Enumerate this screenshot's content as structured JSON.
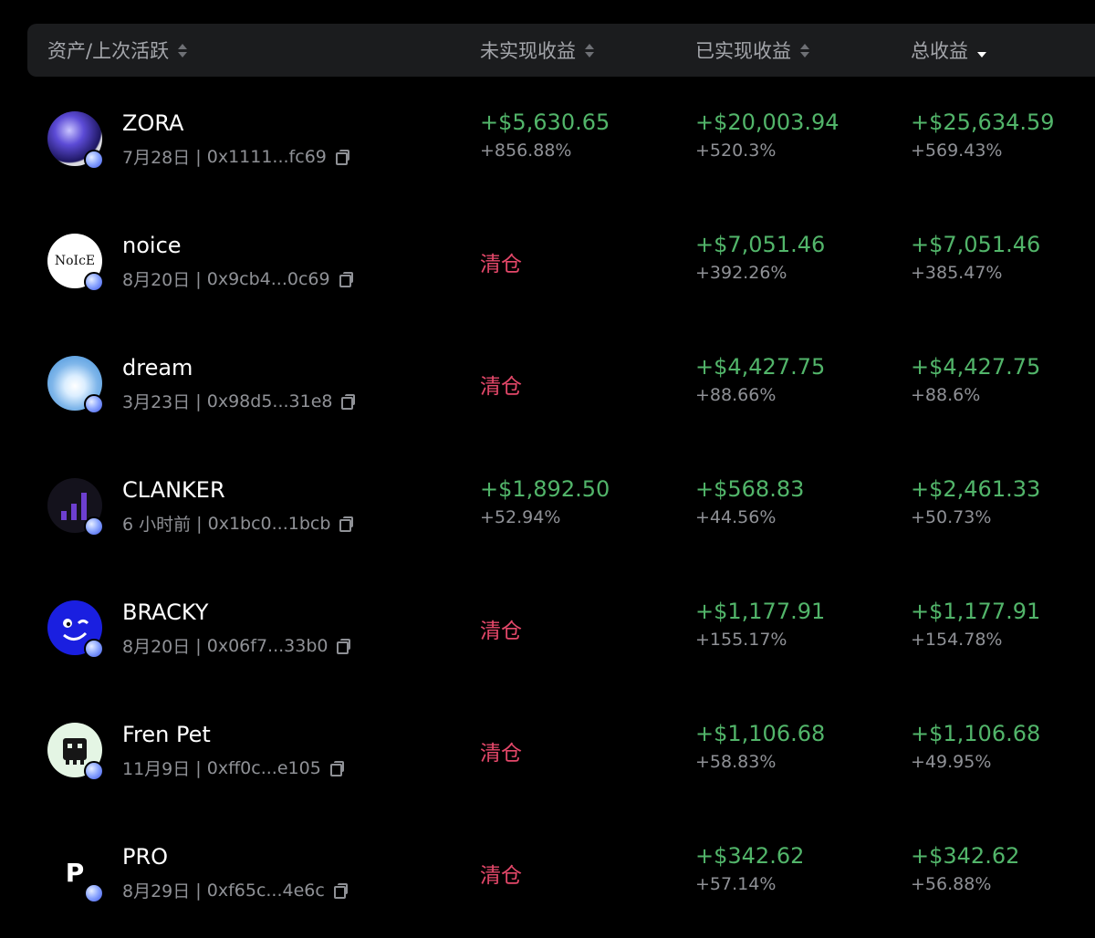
{
  "header": {
    "asset": "资产/上次活跃",
    "unrealized": "未实现收益",
    "realized": "已实现收益",
    "total": "总收益"
  },
  "colors": {
    "positive": "#52b56a",
    "cleared": "#e5486a",
    "muted": "#8f9196",
    "header_bg": "#1b1c1e"
  },
  "rows": [
    {
      "name": "ZORA",
      "date": "7月28日",
      "address": "0x1111...fc69",
      "icon": "zora-orb-icon",
      "unrealized": "+$5,630.65",
      "unrealized_pct": "+856.88%",
      "realized": "+$20,003.94",
      "realized_pct": "+520.3%",
      "total": "+$25,634.59",
      "total_pct": "+569.43%"
    },
    {
      "name": "noice",
      "date": "8月20日",
      "address": "0x9cb4...0c69",
      "icon": "noice-logo-icon",
      "logo_text": "NoIcE",
      "unrealized": "清仓",
      "realized": "+$7,051.46",
      "realized_pct": "+392.26%",
      "total": "+$7,051.46",
      "total_pct": "+385.47%"
    },
    {
      "name": "dream",
      "date": "3月23日",
      "address": "0x98d5...31e8",
      "icon": "sky-cloud-icon",
      "unrealized": "清仓",
      "realized": "+$4,427.75",
      "realized_pct": "+88.66%",
      "total": "+$4,427.75",
      "total_pct": "+88.6%"
    },
    {
      "name": "CLANKER",
      "date": "6 小时前",
      "address": "0x1bc0...1bcb",
      "icon": "bar-chart-icon",
      "unrealized": "+$1,892.50",
      "unrealized_pct": "+52.94%",
      "realized": "+$568.83",
      "realized_pct": "+44.56%",
      "total": "+$2,461.33",
      "total_pct": "+50.73%"
    },
    {
      "name": "BRACKY",
      "date": "8月20日",
      "address": "0x06f7...33b0",
      "icon": "wink-face-icon",
      "unrealized": "清仓",
      "realized": "+$1,177.91",
      "realized_pct": "+155.17%",
      "total": "+$1,177.91",
      "total_pct": "+154.78%"
    },
    {
      "name": "Fren Pet",
      "date": "11月9日",
      "address": "0xff0c...e105",
      "icon": "pixel-pet-icon",
      "unrealized": "清仓",
      "realized": "+$1,106.68",
      "realized_pct": "+58.83%",
      "total": "+$1,106.68",
      "total_pct": "+49.95%"
    },
    {
      "name": "PRO",
      "date": "8月29日",
      "address": "0xf65c...4e6c",
      "icon": "letter-p-icon",
      "logo_text": "P",
      "unrealized": "清仓",
      "realized": "+$342.62",
      "realized_pct": "+57.14%",
      "total": "+$342.62",
      "total_pct": "+56.88%"
    }
  ]
}
